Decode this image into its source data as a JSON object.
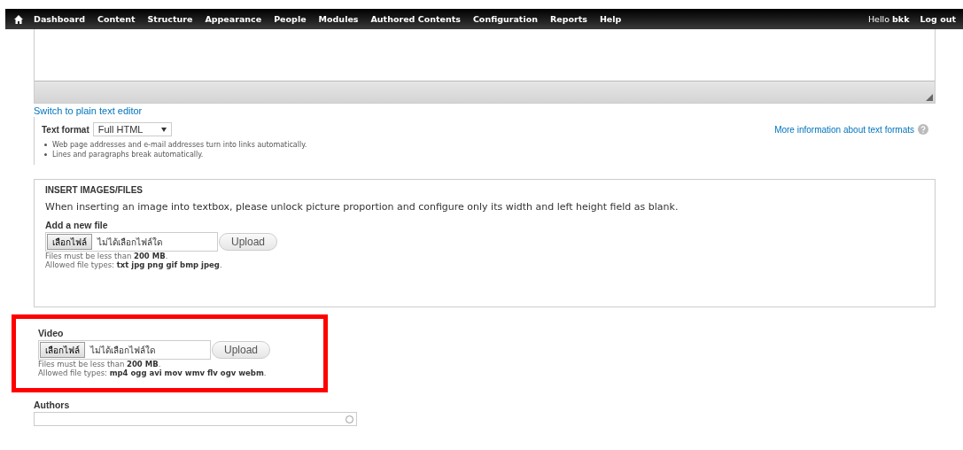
{
  "toolbar": {
    "menu": [
      {
        "label": "Dashboard"
      },
      {
        "label": "Content"
      },
      {
        "label": "Structure"
      },
      {
        "label": "Appearance"
      },
      {
        "label": "People"
      },
      {
        "label": "Modules"
      },
      {
        "label": "Authored Contents"
      },
      {
        "label": "Configuration"
      },
      {
        "label": "Reports"
      },
      {
        "label": "Help"
      }
    ],
    "greeting": "Hello **bkk**",
    "logout": "Log out"
  },
  "editor": {
    "switch_link": "Switch to plain text editor",
    "text_format": {
      "label": "Text format",
      "value": "Full HTML",
      "more_link": "More information about text formats",
      "tips": [
        "Web page addresses and e-mail addresses turn into links automatically.",
        "Lines and paragraphs break automatically."
      ]
    }
  },
  "insert_files": {
    "legend": "INSERT IMAGES/FILES",
    "note": "When inserting an image into textbox, please unlock picture proportion and configure only its width and left height field as blank.",
    "label": "Add a new file",
    "choose_button": "เลือกไฟล์",
    "file_status": "ไม่ได้เลือกไฟล์ใด",
    "upload": "Upload",
    "help": [
      "Files must be less than **200 MB**.",
      "Allowed file types: **txt jpg png gif bmp jpeg**."
    ]
  },
  "video": {
    "highlighted": true,
    "label": "Video",
    "choose_button": "เลือกไฟล์",
    "file_status": "ไม่ได้เลือกไฟล์ใด",
    "upload": "Upload",
    "help": [
      "Files must be less than **200 MB**.",
      "Allowed file types: **mp4 ogg avi mov wmv flv ogv webm**."
    ]
  },
  "authors": {
    "label": "Authors"
  }
}
